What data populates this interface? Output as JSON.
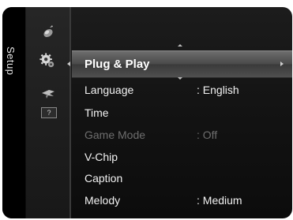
{
  "side_tab": {
    "label": "Setup"
  },
  "icons": [
    {
      "name": "picture-icon"
    },
    {
      "name": "setup-gear-icon"
    },
    {
      "name": "input-icon"
    },
    {
      "name": "support-icon",
      "glyph": "?"
    }
  ],
  "menu": {
    "selected": {
      "label": "Plug & Play"
    },
    "items": [
      {
        "label": "Language",
        "value": ": English",
        "enabled": true
      },
      {
        "label": "Time",
        "value": "",
        "enabled": true
      },
      {
        "label": "Game Mode",
        "value": ": Off",
        "enabled": false
      },
      {
        "label": "V-Chip",
        "value": "",
        "enabled": true
      },
      {
        "label": "Caption",
        "value": "",
        "enabled": true
      },
      {
        "label": "Melody",
        "value": ": Medium",
        "enabled": true
      }
    ]
  },
  "colors": {
    "highlight": "#5a5a5a",
    "text": "#f2f2f2",
    "disabled_text": "#6e6e6e",
    "background": "#151515"
  }
}
